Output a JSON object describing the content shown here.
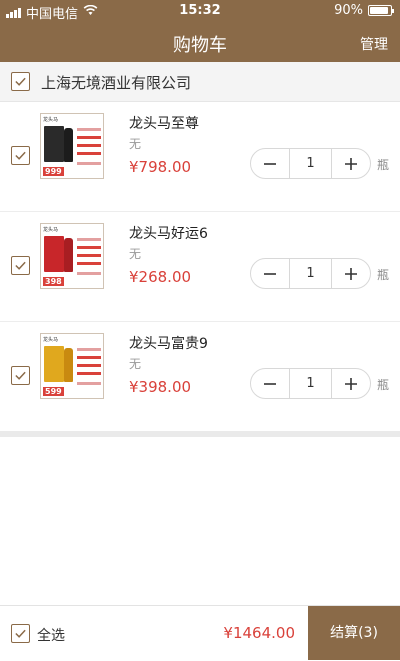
{
  "status_bar": {
    "carrier": "中国电信",
    "time": "15:32",
    "battery": "90%",
    "battery_level": 0.9
  },
  "nav": {
    "title": "购物车",
    "manage_label": "管理"
  },
  "store": {
    "name": "上海无境酒业有限公司",
    "checked": true
  },
  "items": [
    {
      "name": "龙头马至尊",
      "spec": "无",
      "price": "¥798.00",
      "quantity": "1",
      "unit": "瓶",
      "checked": true,
      "image_price": "999",
      "box_color": "#2a2a2a",
      "bottle_color": "#1c1c1c"
    },
    {
      "name": "龙头马好运6",
      "spec": "无",
      "price": "¥268.00",
      "quantity": "1",
      "unit": "瓶",
      "checked": true,
      "image_price": "398",
      "box_color": "#c8262a",
      "bottle_color": "#a81e22"
    },
    {
      "name": "龙头马富贵9",
      "spec": "无",
      "price": "¥398.00",
      "quantity": "1",
      "unit": "瓶",
      "checked": true,
      "image_price": "599",
      "box_color": "#e0a81e",
      "bottle_color": "#c98a10"
    }
  ],
  "footer": {
    "select_all_label": "全选",
    "total": "¥1464.00",
    "checkout_label": "结算(3)"
  },
  "colors": {
    "brand": "#8a6a48",
    "price": "#d9413a"
  }
}
